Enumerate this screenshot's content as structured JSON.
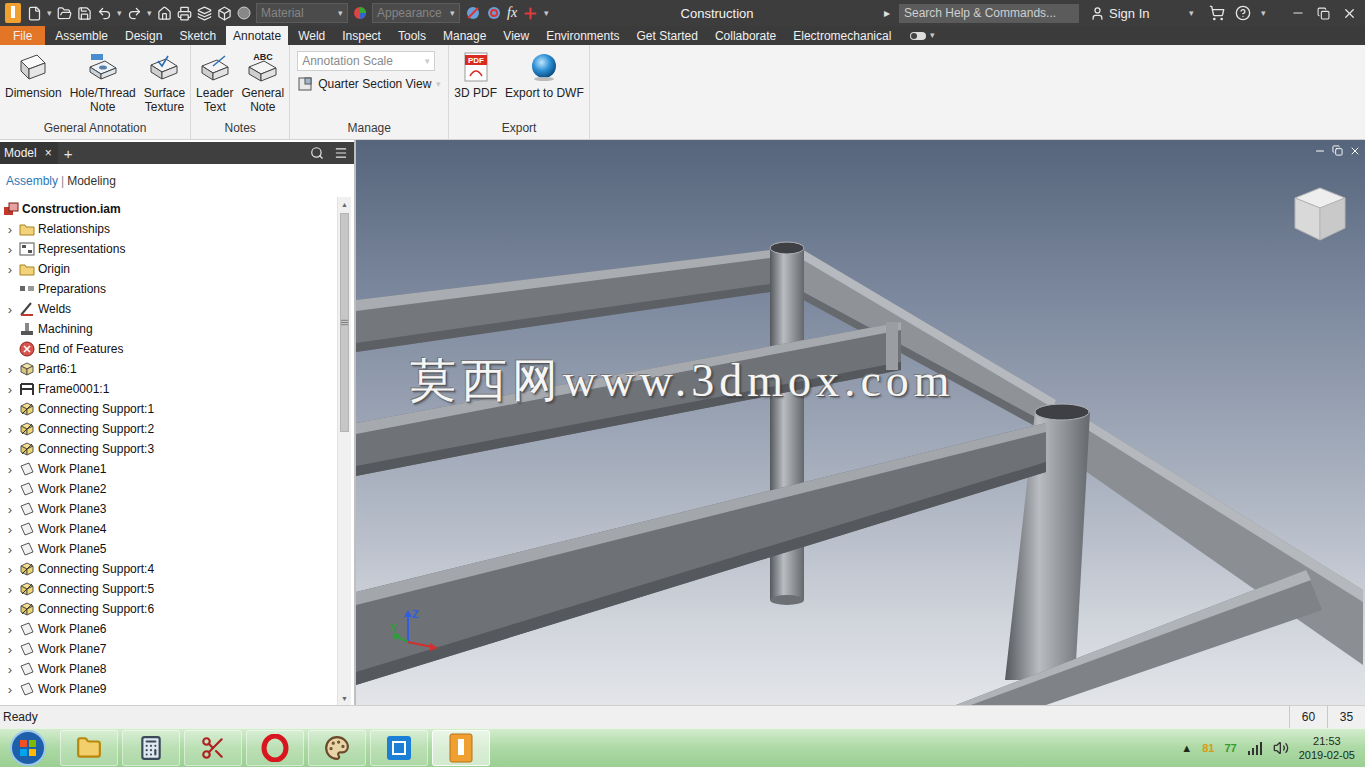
{
  "window": {
    "title": "Construction",
    "title_arrow": "▸",
    "search": {
      "placeholder": "Search Help & Commands..."
    },
    "sign_in": "Sign In",
    "caret": "▾"
  },
  "quick_access": {
    "caret": "▾",
    "material": {
      "placeholder": "Material",
      "disabled": true
    },
    "appearance": {
      "placeholder": "Appearance",
      "disabled": true
    },
    "formula": "fx"
  },
  "ribbon_tabs": [
    {
      "label": "File",
      "kind": "file",
      "selected": false
    },
    {
      "label": "Assemble",
      "kind": "tab",
      "selected": false
    },
    {
      "label": "Design",
      "kind": "tab",
      "selected": false
    },
    {
      "label": "Sketch",
      "kind": "tab",
      "selected": false
    },
    {
      "label": "Annotate",
      "kind": "tab",
      "selected": true
    },
    {
      "label": "Weld",
      "kind": "tab",
      "selected": false
    },
    {
      "label": "Inspect",
      "kind": "tab",
      "selected": false
    },
    {
      "label": "Tools",
      "kind": "tab",
      "selected": false
    },
    {
      "label": "Manage",
      "kind": "tab",
      "selected": false
    },
    {
      "label": "View",
      "kind": "tab",
      "selected": false
    },
    {
      "label": "Environments",
      "kind": "tab",
      "selected": false
    },
    {
      "label": "Get Started",
      "kind": "tab",
      "selected": false
    },
    {
      "label": "Collaborate",
      "kind": "tab",
      "selected": false
    },
    {
      "label": "Electromechanical",
      "kind": "tab",
      "selected": false
    }
  ],
  "ribbon_groups": [
    {
      "title": "General Annotation",
      "items": [
        {
          "kind": "stacked",
          "label": "Dimension"
        },
        {
          "kind": "stacked",
          "label": "Hole/Thread Note"
        },
        {
          "kind": "stacked",
          "label": "Surface Texture"
        }
      ]
    },
    {
      "title": "Notes",
      "items": [
        {
          "kind": "stacked",
          "label": "Leader Text"
        },
        {
          "kind": "stacked",
          "label": "General Note",
          "badge": "ABC"
        }
      ]
    },
    {
      "title": "Manage",
      "items": [
        {
          "kind": "dropdown",
          "label": "Annotation Scale",
          "disabled": true,
          "caret": "▾"
        },
        {
          "kind": "menu-button",
          "label": "Quarter Section View",
          "caret": "▾"
        }
      ]
    },
    {
      "title": "Export",
      "items": [
        {
          "kind": "inline",
          "label": "3D PDF",
          "badge": "PDF"
        },
        {
          "kind": "inline",
          "label": "Export to DWF"
        }
      ]
    }
  ],
  "browser": {
    "tab": "Model",
    "close": "×",
    "add": "+",
    "modes": [
      {
        "label": "Assembly",
        "selected": true
      },
      {
        "label": "Modeling",
        "selected": false
      }
    ],
    "separator": "|",
    "expander": "›",
    "scrollbar": {
      "level": 0.46,
      "up": "▲",
      "down": "▼"
    },
    "tree": [
      {
        "label": "Construction.iam",
        "kind": "assembly",
        "has_children": false,
        "expanded": false
      },
      {
        "label": "Relationships",
        "kind": "folder",
        "has_children": true,
        "expanded": false
      },
      {
        "label": "Representations",
        "kind": "representations",
        "has_children": true,
        "expanded": false
      },
      {
        "label": "Origin",
        "kind": "folder",
        "has_children": true,
        "expanded": false
      },
      {
        "label": "Preparations",
        "kind": "preparations",
        "has_children": false,
        "expanded": false
      },
      {
        "label": "Welds",
        "kind": "welds",
        "has_children": true,
        "expanded": false
      },
      {
        "label": "Machining",
        "kind": "machining",
        "has_children": false,
        "expanded": false
      },
      {
        "label": "End of Features",
        "kind": "end",
        "has_children": false,
        "expanded": false
      },
      {
        "label": "Part6:1",
        "kind": "part",
        "has_children": true,
        "expanded": false
      },
      {
        "label": "Frame0001:1",
        "kind": "frame",
        "has_children": true,
        "expanded": false
      },
      {
        "label": "Connecting Support:1",
        "kind": "support",
        "has_children": true,
        "expanded": false
      },
      {
        "label": "Connecting Support:2",
        "kind": "support",
        "has_children": true,
        "expanded": false
      },
      {
        "label": "Connecting Support:3",
        "kind": "support",
        "has_children": true,
        "expanded": false
      },
      {
        "label": "Work Plane1",
        "kind": "work-plane",
        "has_children": true,
        "expanded": false
      },
      {
        "label": "Work Plane2",
        "kind": "work-plane",
        "has_children": true,
        "expanded": false
      },
      {
        "label": "Work Plane3",
        "kind": "work-plane",
        "has_children": true,
        "expanded": false
      },
      {
        "label": "Work Plane4",
        "kind": "work-plane",
        "has_children": true,
        "expanded": false
      },
      {
        "label": "Work Plane5",
        "kind": "work-plane",
        "has_children": true,
        "expanded": false
      },
      {
        "label": "Connecting Support:4",
        "kind": "support",
        "has_children": true,
        "expanded": false
      },
      {
        "label": "Connecting Support:5",
        "kind": "support",
        "has_children": true,
        "expanded": false
      },
      {
        "label": "Connecting Support:6",
        "kind": "support",
        "has_children": true,
        "expanded": false
      },
      {
        "label": "Work Plane6",
        "kind": "work-plane",
        "has_children": true,
        "expanded": false
      },
      {
        "label": "Work Plane7",
        "kind": "work-plane",
        "has_children": true,
        "expanded": false
      },
      {
        "label": "Work Plane8",
        "kind": "work-plane",
        "has_children": true,
        "expanded": false
      },
      {
        "label": "Work Plane9",
        "kind": "work-plane",
        "has_children": true,
        "expanded": false
      }
    ]
  },
  "viewport": {
    "watermark": "莫西网www.3dmox.com",
    "axes": [
      {
        "label": "Z",
        "color": "#2f5fe0"
      },
      {
        "label": "Y",
        "color": "#2e9e3a"
      }
    ]
  },
  "status_bar": {
    "text": "Ready",
    "cells": [
      "60",
      "35"
    ]
  },
  "taskbar": {
    "apps": [
      {
        "selected": false
      },
      {
        "selected": false
      },
      {
        "selected": false
      },
      {
        "selected": false
      },
      {
        "selected": false
      },
      {
        "selected": false
      },
      {
        "selected": true
      }
    ],
    "tray": {
      "expand": "▲",
      "counters": [
        {
          "value": "81",
          "color": "#d99a12"
        },
        {
          "value": "77",
          "color": "#2f9e2f"
        }
      ],
      "time": "21:53",
      "date": "2019-02-05"
    }
  }
}
